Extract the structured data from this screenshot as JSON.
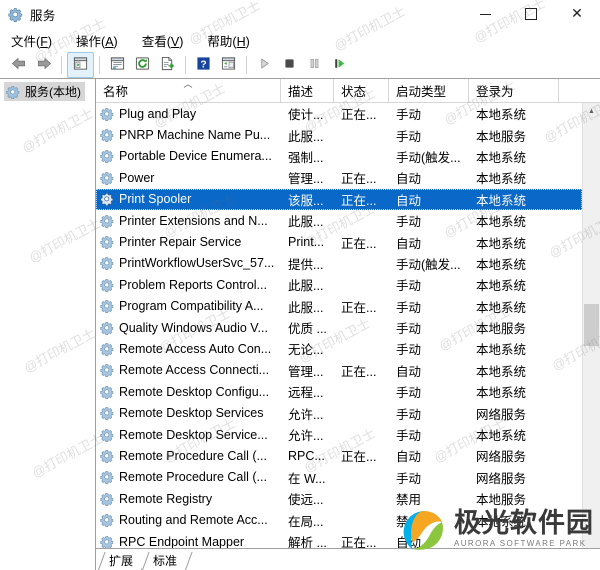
{
  "window": {
    "title": "服务",
    "icon": "services-gear-icon",
    "controls": {
      "minimize": "最小化",
      "maximize": "最大化",
      "close": "关闭"
    }
  },
  "menubar": [
    {
      "name": "file",
      "label": "文件",
      "accel": "F"
    },
    {
      "name": "action",
      "label": "操作",
      "accel": "A"
    },
    {
      "name": "view",
      "label": "查看",
      "accel": "V"
    },
    {
      "name": "help",
      "label": "帮助",
      "accel": "H"
    }
  ],
  "toolbar": [
    {
      "name": "back",
      "icon": "back-arrow-icon",
      "enabled": false
    },
    {
      "name": "forward",
      "icon": "forward-arrow-icon",
      "enabled": false
    },
    {
      "name": "show-hide-console-tree",
      "icon": "console-tree-icon",
      "active": true
    },
    {
      "name": "properties",
      "icon": "properties-window-icon"
    },
    {
      "name": "refresh",
      "icon": "refresh-icon"
    },
    {
      "name": "export-list",
      "icon": "export-list-icon"
    },
    {
      "name": "help",
      "icon": "help-question-icon"
    },
    {
      "name": "show-action-pane",
      "icon": "action-pane-icon"
    },
    {
      "name": "start-service",
      "icon": "play-icon",
      "enabled": false
    },
    {
      "name": "stop-service",
      "icon": "stop-icon",
      "enabled": true
    },
    {
      "name": "pause-service",
      "icon": "pause-icon",
      "enabled": false
    },
    {
      "name": "restart-service",
      "icon": "restart-icon",
      "enabled": true
    }
  ],
  "sidebar": {
    "root": {
      "label": "服务(本地)",
      "icon": "services-gear-icon",
      "selected": true
    }
  },
  "columns": [
    {
      "key": "name",
      "label": "名称",
      "sorted": "asc"
    },
    {
      "key": "desc",
      "label": "描述"
    },
    {
      "key": "state",
      "label": "状态"
    },
    {
      "key": "start",
      "label": "启动类型"
    },
    {
      "key": "logon",
      "label": "登录为"
    }
  ],
  "rows": [
    {
      "name": "Plug and Play",
      "desc": "使计...",
      "state": "正在...",
      "start": "手动",
      "logon": "本地系统",
      "selected": false
    },
    {
      "name": "PNRP Machine Name Pu...",
      "desc": "此服...",
      "state": "",
      "start": "手动",
      "logon": "本地服务",
      "selected": false
    },
    {
      "name": "Portable Device Enumera...",
      "desc": "强制...",
      "state": "",
      "start": "手动(触发...",
      "logon": "本地系统",
      "selected": false
    },
    {
      "name": "Power",
      "desc": "管理...",
      "state": "正在...",
      "start": "自动",
      "logon": "本地系统",
      "selected": false
    },
    {
      "name": "Print Spooler",
      "desc": "该服...",
      "state": "正在...",
      "start": "自动",
      "logon": "本地系统",
      "selected": true
    },
    {
      "name": "Printer Extensions and N...",
      "desc": "此服...",
      "state": "",
      "start": "手动",
      "logon": "本地系统",
      "selected": false
    },
    {
      "name": "Printer Repair Service",
      "desc": "Print...",
      "state": "正在...",
      "start": "自动",
      "logon": "本地系统",
      "selected": false
    },
    {
      "name": "PrintWorkflowUserSvc_57...",
      "desc": "提供...",
      "state": "",
      "start": "手动(触发...",
      "logon": "本地系统",
      "selected": false
    },
    {
      "name": "Problem Reports Control...",
      "desc": "此服...",
      "state": "",
      "start": "手动",
      "logon": "本地系统",
      "selected": false
    },
    {
      "name": "Program Compatibility A...",
      "desc": "此服...",
      "state": "正在...",
      "start": "手动",
      "logon": "本地系统",
      "selected": false
    },
    {
      "name": "Quality Windows Audio V...",
      "desc": "优质 ...",
      "state": "",
      "start": "手动",
      "logon": "本地服务",
      "selected": false
    },
    {
      "name": "Remote Access Auto Con...",
      "desc": "无论...",
      "state": "",
      "start": "手动",
      "logon": "本地系统",
      "selected": false
    },
    {
      "name": "Remote Access Connecti...",
      "desc": "管理...",
      "state": "正在...",
      "start": "自动",
      "logon": "本地系统",
      "selected": false
    },
    {
      "name": "Remote Desktop Configu...",
      "desc": "远程...",
      "state": "",
      "start": "手动",
      "logon": "本地系统",
      "selected": false
    },
    {
      "name": "Remote Desktop Services",
      "desc": "允许...",
      "state": "",
      "start": "手动",
      "logon": "网络服务",
      "selected": false
    },
    {
      "name": "Remote Desktop Service...",
      "desc": "允许...",
      "state": "",
      "start": "手动",
      "logon": "本地系统",
      "selected": false
    },
    {
      "name": "Remote Procedure Call (...",
      "desc": "RPC...",
      "state": "正在...",
      "start": "自动",
      "logon": "网络服务",
      "selected": false
    },
    {
      "name": "Remote Procedure Call (...",
      "desc": "在 W...",
      "state": "",
      "start": "手动",
      "logon": "网络服务",
      "selected": false
    },
    {
      "name": "Remote Registry",
      "desc": "使远...",
      "state": "",
      "start": "禁用",
      "logon": "本地服务",
      "selected": false
    },
    {
      "name": "Routing and Remote Acc...",
      "desc": "在局...",
      "state": "",
      "start": "禁用",
      "logon": "本地系统",
      "selected": false
    },
    {
      "name": "RPC Endpoint Mapper",
      "desc": "解析 ...",
      "state": "正在...",
      "start": "自动",
      "logon": "",
      "selected": false
    }
  ],
  "tabs": [
    {
      "name": "extended",
      "label": "扩展",
      "active": false
    },
    {
      "name": "standard",
      "label": "标准",
      "active": true
    }
  ],
  "watermark": {
    "text": "@打印机卫士"
  },
  "logo": {
    "cn": "极光软件园",
    "en": "AURORA SOFTWARE PARK"
  },
  "colors": {
    "selection": "#0a68c8",
    "toolbar_active": "#e3f1fb",
    "tree_selected": "#d6d6d6",
    "logo_blue": "#00b0e8",
    "logo_orange": "#f5a623",
    "logo_green": "#8cc63f"
  }
}
